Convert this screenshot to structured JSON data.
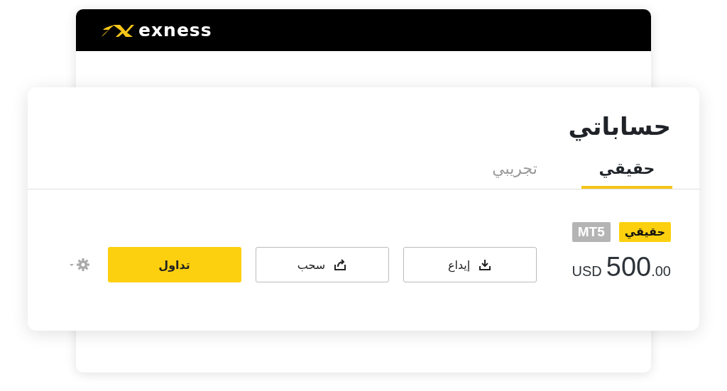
{
  "header": {
    "brand": "exness"
  },
  "page": {
    "title": "حساباتي"
  },
  "tabs": [
    {
      "label": "حقيقي",
      "selected": true
    },
    {
      "label": "تجريبي",
      "selected": false
    }
  ],
  "account": {
    "badges": [
      {
        "label": "حقيقي",
        "kind": "type"
      },
      {
        "label": "MT5",
        "kind": "platform"
      }
    ],
    "balance": {
      "whole": "500",
      "fraction": ".00",
      "currency": "USD"
    },
    "buttons": [
      {
        "label": "إيداع",
        "kind": "deposit"
      },
      {
        "label": "سحب",
        "kind": "withdraw"
      },
      {
        "label": "تداول",
        "kind": "trade"
      }
    ]
  }
}
